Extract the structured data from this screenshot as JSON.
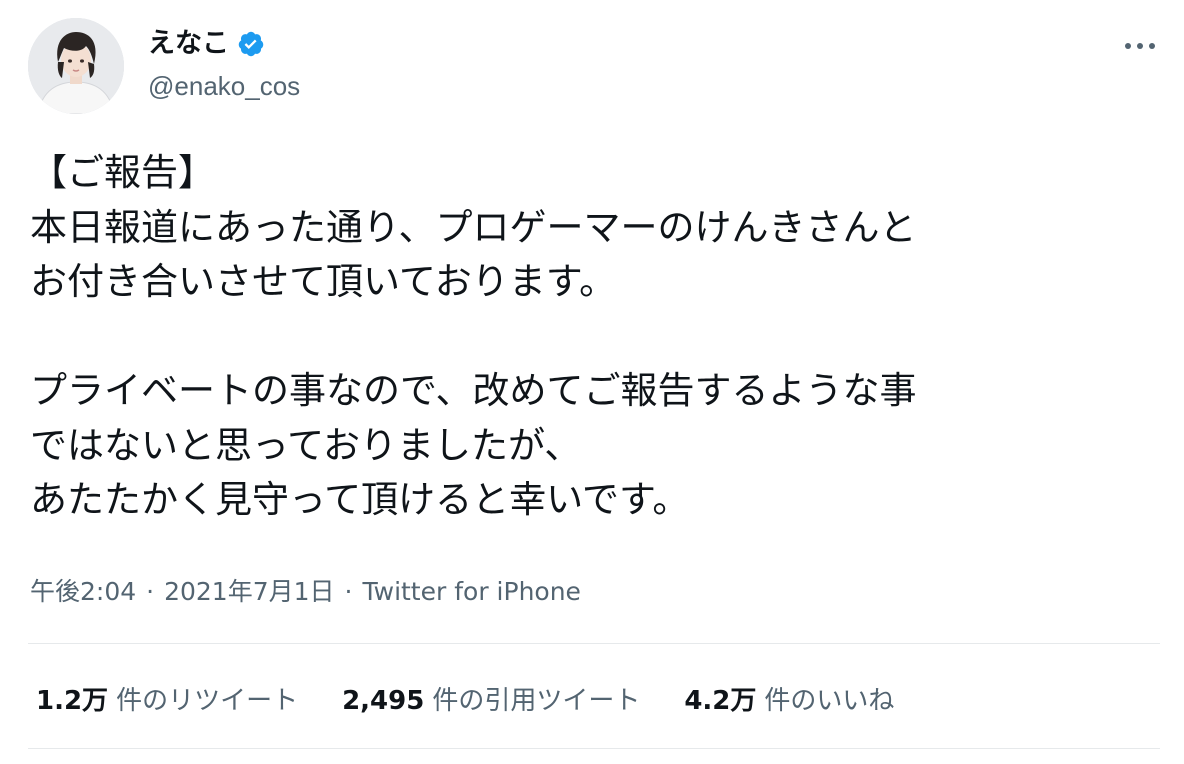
{
  "user": {
    "display_name": "えなこ",
    "handle": "@enako_cos",
    "verified": true
  },
  "tweet": {
    "text": "【ご報告】\n本日報道にあった通り、プロゲーマーのけんきさんと\nお付き合いさせて頂いております。\n\nプライベートの事なので、改めてご報告するような事\nではないと思っておりましたが、\nあたたかく見守って頂けると幸いです。",
    "time": "午後2:04",
    "separator": "·",
    "date": "2021年7月1日",
    "source": "Twitter for iPhone"
  },
  "stats": {
    "retweets": {
      "count": "1.2万",
      "label": "件のリツイート"
    },
    "quotes": {
      "count": "2,495",
      "label": "件の引用ツイート"
    },
    "likes": {
      "count": "4.2万",
      "label": "件のいいね"
    }
  },
  "icons": {
    "verified": "verified-badge-icon",
    "more": "more-options-icon"
  },
  "colors": {
    "text": "#0f1419",
    "secondary": "#536471",
    "verified": "#1d9bf0",
    "divider": "#e6e9eb"
  }
}
